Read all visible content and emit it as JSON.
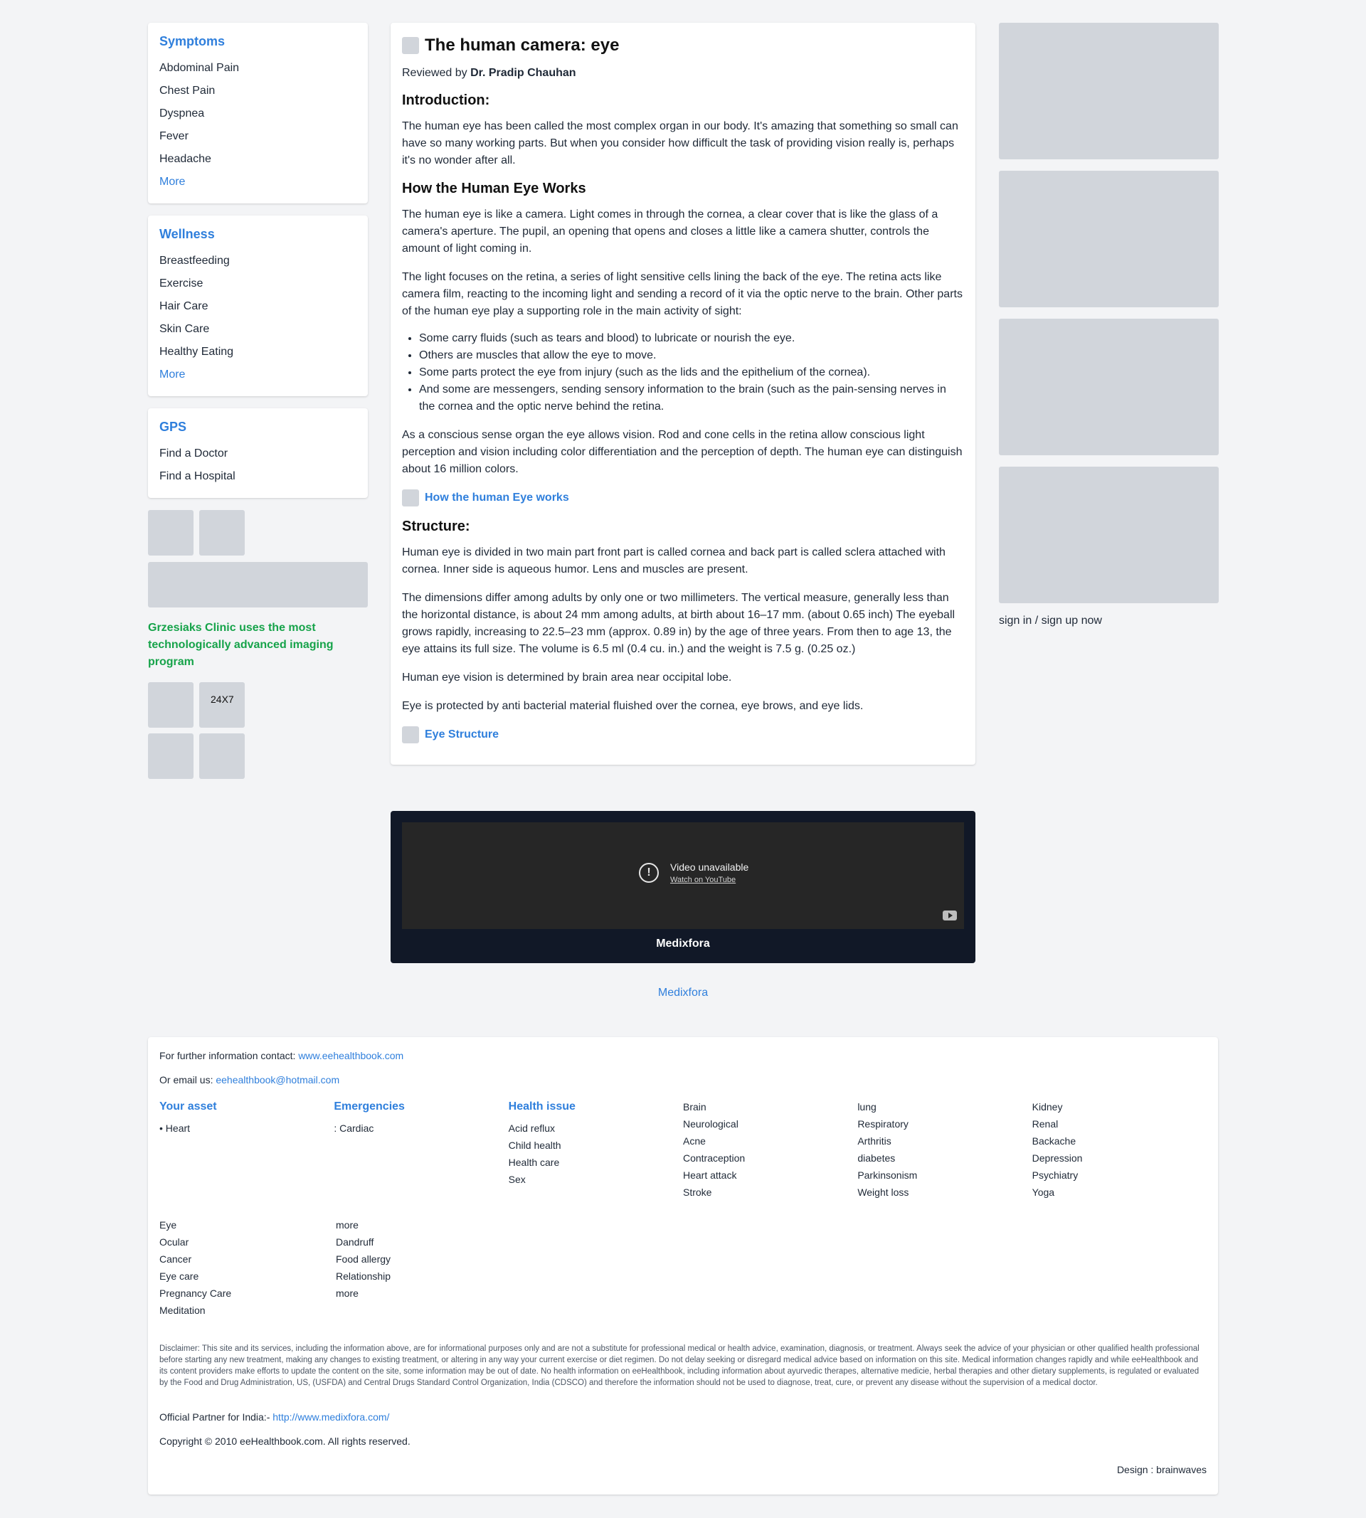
{
  "sidebar": {
    "symptoms": {
      "title": "Symptoms",
      "items": [
        "Abdominal Pain",
        "Chest Pain",
        "Dyspnea",
        "Fever",
        "Headache"
      ],
      "more": "More"
    },
    "wellness": {
      "title": "Wellness",
      "items": [
        "Breastfeeding",
        "Exercise",
        "Hair Care",
        "Skin Care",
        "Healthy Eating"
      ],
      "more": "More"
    },
    "gps": {
      "title": "GPS",
      "items": [
        "Find a Doctor",
        "Find a Hospital"
      ]
    },
    "clinic_text": "Grzesiaks Clinic uses the most technologically advanced imaging program",
    "badge_247": "24X7"
  },
  "article": {
    "title": "The human camera: eye",
    "reviewed_prefix": "Reviewed by",
    "reviewer": "Dr. Pradip Chauhan",
    "intro_heading": "Introduction:",
    "intro_text": "The human eye has been called the most complex organ in our body. It's amazing that something so small can have so many working parts. But when you consider how difficult the task of providing vision really is, perhaps it's no wonder after all.",
    "works_heading": "How the Human Eye Works",
    "works_p1": "The human eye is like a camera. Light comes in through the cornea, a clear cover that is like the glass of a camera's aperture. The pupil, an opening that opens and closes a little like a camera shutter, controls the amount of light coming in.",
    "works_p2": "The light focuses on the retina, a series of light sensitive cells lining the back of the eye. The retina acts like camera film, reacting to the incoming light and sending a record of it via the optic nerve to the brain. Other parts of the human eye play a supporting role in the main activity of sight:",
    "bullets": [
      "Some carry fluids (such as tears and blood) to lubricate or nourish the eye.",
      "Others are muscles that allow the eye to move.",
      "Some parts protect the eye from injury (such as the lids and the epithelium of the cornea).",
      "And some are messengers, sending sensory information to the brain (such as the pain-sensing nerves in the cornea and the optic nerve behind the retina."
    ],
    "works_p3": "As a conscious sense organ the eye allows vision. Rod and cone cells in the retina allow conscious light perception and vision including color differentiation and the perception of depth. The human eye can distinguish about 16 million colors.",
    "link1": "How the human Eye works",
    "structure_heading": "Structure:",
    "structure_p1": "Human eye is divided in two main part front part is called cornea and back part is called sclera attached with cornea. Inner side is aqueous humor. Lens and muscles are present.",
    "structure_p2": "The dimensions differ among adults by only one or two millimeters. The vertical measure, generally less than the horizontal distance, is about 24 mm among adults, at birth about 16–17 mm. (about 0.65 inch) The eyeball grows rapidly, increasing to 22.5–23 mm (approx. 0.89 in) by the age of three years. From then to age 13, the eye attains its full size. The volume is 6.5 ml (0.4 cu. in.) and the weight is 7.5 g. (0.25 oz.)",
    "structure_p3": "Human eye vision is determined by brain area near occipital lobe.",
    "structure_p4": "Eye is protected by anti bacterial material fluished over the cornea, eye brows, and eye lids.",
    "link2": "Eye Structure"
  },
  "video": {
    "unavailable": "Video unavailable",
    "watch": "Watch on YouTube",
    "caption": "Medixfora",
    "alert_glyph": "!"
  },
  "below_video_link": "Medixfora",
  "right": {
    "signin": "sign in / sign up now"
  },
  "footer": {
    "contact_prefix": "For further information contact:",
    "contact_link": "www.eehealthbook.com",
    "email_prefix": "Or email us:",
    "email_link": "eehealthbook@hotmail.com",
    "columns": [
      {
        "title": "Your asset",
        "items": [
          "• Heart"
        ]
      },
      {
        "title": "Emergencies",
        "items": [
          ": Cardiac"
        ]
      },
      {
        "title": "Health issue",
        "items": [
          "Acid reflux",
          "Child health",
          "Health care",
          "Sex"
        ]
      },
      {
        "title": "",
        "items": [
          "Brain",
          "Neurological",
          "Acne",
          "Contraception",
          "Heart attack",
          "Stroke"
        ]
      },
      {
        "title": "",
        "items": [
          "lung",
          "Respiratory",
          "Arthritis",
          "diabetes",
          "Parkinsonism",
          "Weight loss"
        ]
      },
      {
        "title": "",
        "items": [
          "Kidney",
          "Renal",
          "Backache",
          "Depression",
          "Psychiatry",
          "Yoga"
        ]
      }
    ],
    "columns2": [
      {
        "items": [
          "Eye",
          "Ocular",
          "Cancer",
          "Eye care",
          "Pregnancy Care",
          "Meditation"
        ]
      },
      {
        "items": [
          "more",
          "Dandruff",
          "Food allergy",
          "Relationship",
          "more"
        ]
      }
    ],
    "disclaimer": "Disclaimer: This site and its services, including the information above, are for informational purposes only and are not a substitute for professional medical or health advice, examination, diagnosis, or treatment. Always seek the advice of your physician or other qualified health professional before starting any new treatment, making any changes to existing treatment, or altering in any way your current exercise or diet regimen. Do not delay seeking or disregard medical advice based on information on this site. Medical information changes rapidly and while eeHealthbook and its content providers make efforts to update the content on the site, some information may be out of date. No health information on eeHealthbook, including information about ayurvedic therapes, alternative medicie, herbal therapies and other dietary supplements, is regulated or evaluated by the Food and Drug Administration, US, (USFDA) and Central Drugs Standard Control Organization, India (CDSCO) and therefore the information should not be used to diagnose, treat, cure, or prevent any disease without the supervision of a medical doctor.",
    "partner_prefix": "Official Partner for India:-",
    "partner_link": "http://www.medixfora.com/",
    "copyright": "Copyright © 2010 eeHealthbook.com. All rights reserved.",
    "design": "Design : brainwaves"
  },
  "colors": {
    "accent": "#2f7fdc",
    "green": "#16a34a",
    "placeholder": "#d1d5db",
    "video_bg": "#111827"
  }
}
